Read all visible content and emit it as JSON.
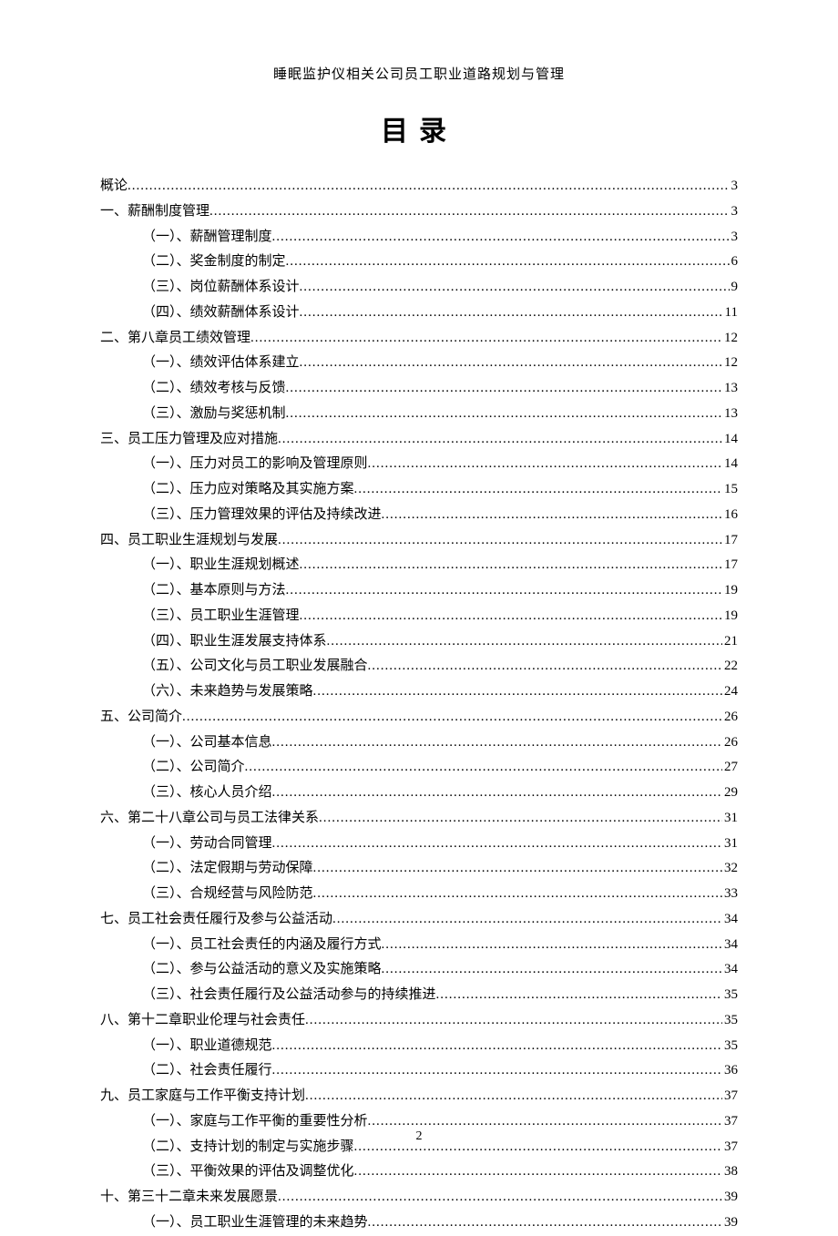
{
  "header": "睡眠监护仪相关公司员工职业道路规划与管理",
  "toc_title": "目录",
  "page_number": "2",
  "entries": [
    {
      "level": 0,
      "label": "概论",
      "page": "3"
    },
    {
      "level": 0,
      "label": "一、薪酬制度管理",
      "page": "3"
    },
    {
      "level": 1,
      "label": "（一）、薪酬管理制度",
      "page": "3"
    },
    {
      "level": 1,
      "label": "（二）、奖金制度的制定",
      "page": "6"
    },
    {
      "level": 1,
      "label": "（三）、岗位薪酬体系设计",
      "page": "9"
    },
    {
      "level": 1,
      "label": "（四）、绩效薪酬体系设计",
      "page": "11"
    },
    {
      "level": 0,
      "label": "二、第八章员工绩效管理",
      "page": "12"
    },
    {
      "level": 1,
      "label": "（一）、绩效评估体系建立",
      "page": "12"
    },
    {
      "level": 1,
      "label": "（二）、绩效考核与反馈",
      "page": "13"
    },
    {
      "level": 1,
      "label": "（三）、激励与奖惩机制",
      "page": "13"
    },
    {
      "level": 0,
      "label": "三、员工压力管理及应对措施",
      "page": "14"
    },
    {
      "level": 1,
      "label": "（一）、压力对员工的影响及管理原则",
      "page": "14"
    },
    {
      "level": 1,
      "label": "（二）、压力应对策略及其实施方案",
      "page": "15"
    },
    {
      "level": 1,
      "label": "（三）、压力管理效果的评估及持续改进",
      "page": "16"
    },
    {
      "level": 0,
      "label": "四、员工职业生涯规划与发展",
      "page": "17"
    },
    {
      "level": 1,
      "label": "（一）、职业生涯规划概述",
      "page": "17"
    },
    {
      "level": 1,
      "label": "（二）、基本原则与方法",
      "page": "19"
    },
    {
      "level": 1,
      "label": "（三）、员工职业生涯管理",
      "page": "19"
    },
    {
      "level": 1,
      "label": "（四）、职业生涯发展支持体系",
      "page": "21"
    },
    {
      "level": 1,
      "label": "（五）、公司文化与员工职业发展融合",
      "page": "22"
    },
    {
      "level": 1,
      "label": "（六）、未来趋势与发展策略",
      "page": "24"
    },
    {
      "level": 0,
      "label": "五、公司简介",
      "page": "26"
    },
    {
      "level": 1,
      "label": "（一）、公司基本信息",
      "page": "26"
    },
    {
      "level": 1,
      "label": "（二）、公司简介",
      "page": "27"
    },
    {
      "level": 1,
      "label": "（三）、核心人员介绍",
      "page": "29"
    },
    {
      "level": 0,
      "label": "六、第二十八章公司与员工法律关系",
      "page": "31"
    },
    {
      "level": 1,
      "label": "（一）、劳动合同管理",
      "page": "31"
    },
    {
      "level": 1,
      "label": "（二）、法定假期与劳动保障",
      "page": "32"
    },
    {
      "level": 1,
      "label": "（三）、合规经营与风险防范",
      "page": "33"
    },
    {
      "level": 0,
      "label": "七、员工社会责任履行及参与公益活动",
      "page": "34"
    },
    {
      "level": 1,
      "label": "（一）、员工社会责任的内涵及履行方式",
      "page": "34"
    },
    {
      "level": 1,
      "label": "（二）、参与公益活动的意义及实施策略",
      "page": "34"
    },
    {
      "level": 1,
      "label": "（三）、社会责任履行及公益活动参与的持续推进",
      "page": "35"
    },
    {
      "level": 0,
      "label": "八、第十二章职业伦理与社会责任",
      "page": "35"
    },
    {
      "level": 1,
      "label": "（一）、职业道德规范",
      "page": "35"
    },
    {
      "level": 1,
      "label": "（二）、社会责任履行",
      "page": "36"
    },
    {
      "level": 0,
      "label": "九、员工家庭与工作平衡支持计划",
      "page": "37"
    },
    {
      "level": 1,
      "label": "（一）、家庭与工作平衡的重要性分析",
      "page": "37"
    },
    {
      "level": 1,
      "label": "（二）、支持计划的制定与实施步骤",
      "page": "37"
    },
    {
      "level": 1,
      "label": "（三）、平衡效果的评估及调整优化",
      "page": "38"
    },
    {
      "level": 0,
      "label": "十、第三十二章未来发展愿景",
      "page": "39"
    },
    {
      "level": 1,
      "label": "（一）、员工职业生涯管理的未来趋势",
      "page": "39"
    }
  ]
}
